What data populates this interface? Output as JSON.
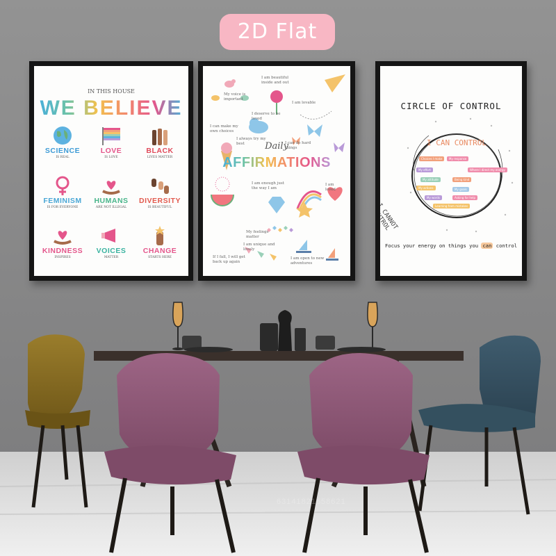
{
  "badge": {
    "label": "2D Flat"
  },
  "poster1": {
    "subtitle": "IN THIS HOUSE",
    "title": "WE BELIEVE",
    "items": [
      {
        "title": "SCIENCE",
        "sub": "IS REAL",
        "color": "#3d9bd6",
        "icon": "globe-icon"
      },
      {
        "title": "LOVE",
        "sub": "IS LOVE",
        "color": "#e4568b",
        "icon": "rainbow-flag-icon"
      },
      {
        "title": "BLACK",
        "sub": "LIVES MATTER",
        "color": "#e04a5a",
        "icon": "raised-fists-icon"
      },
      {
        "title": "FEMINISM",
        "sub": "IS FOR EVERYONE",
        "color": "#4aa7d6",
        "icon": "female-symbol-icon"
      },
      {
        "title": "HUMANS",
        "sub": "ARE NOT ILLEGAL",
        "color": "#48b58a",
        "icon": "heart-hands-icon"
      },
      {
        "title": "DIVERSITY",
        "sub": "IS BEAUTIFUL",
        "color": "#e25a4e",
        "icon": "diverse-hands-icon"
      },
      {
        "title": "KINDNESS",
        "sub": "INSPIRES",
        "color": "#e4568b",
        "icon": "heart-hands-icon"
      },
      {
        "title": "VOICES",
        "sub": "MATTER",
        "color": "#3ab3a0",
        "icon": "megaphone-icon"
      },
      {
        "title": "CHANGE",
        "sub": "STARTS HERE",
        "color": "#e4568b",
        "icon": "raised-fist-icon"
      }
    ]
  },
  "poster2": {
    "title_script": "Daily",
    "title": "AFFIRMATIONS",
    "notes": [
      "I am beautiful inside and out",
      "My voice is important",
      "I deserve to be loved",
      "I am lovable",
      "I can make my own choices",
      "I always try my best",
      "I am enough just the way I am",
      "I am loved",
      "I can do hard things",
      "If I fall, I will get back up again",
      "My feelings matter",
      "I am unique and lovely",
      "I am open to new adventures"
    ]
  },
  "poster3": {
    "title": "CIRCLE OF CONTROL",
    "inner_label": "I CAN CONTROL",
    "outer_label": "I CANNOT CONTROL",
    "chips": [
      {
        "text": "Choices I make",
        "color": "#f2a07b"
      },
      {
        "text": "My response",
        "color": "#f08cab"
      },
      {
        "text": "My effort",
        "color": "#b99ad8"
      },
      {
        "text": "Where I direct my energy",
        "color": "#f08cab"
      },
      {
        "text": "My attitude",
        "color": "#9ad0b8"
      },
      {
        "text": "Being kind",
        "color": "#f2a07b"
      },
      {
        "text": "My actions",
        "color": "#f4c36a"
      },
      {
        "text": "My goals",
        "color": "#a4c9e8"
      },
      {
        "text": "My words",
        "color": "#b99ad8"
      },
      {
        "text": "Asking for help",
        "color": "#f08cab"
      },
      {
        "text": "Learning from mistakes",
        "color": "#f4c36a"
      }
    ],
    "footer_before": "Focus your energy on things you",
    "footer_highlight": "can",
    "footer_after": "control"
  },
  "watermark": "63141821658621"
}
